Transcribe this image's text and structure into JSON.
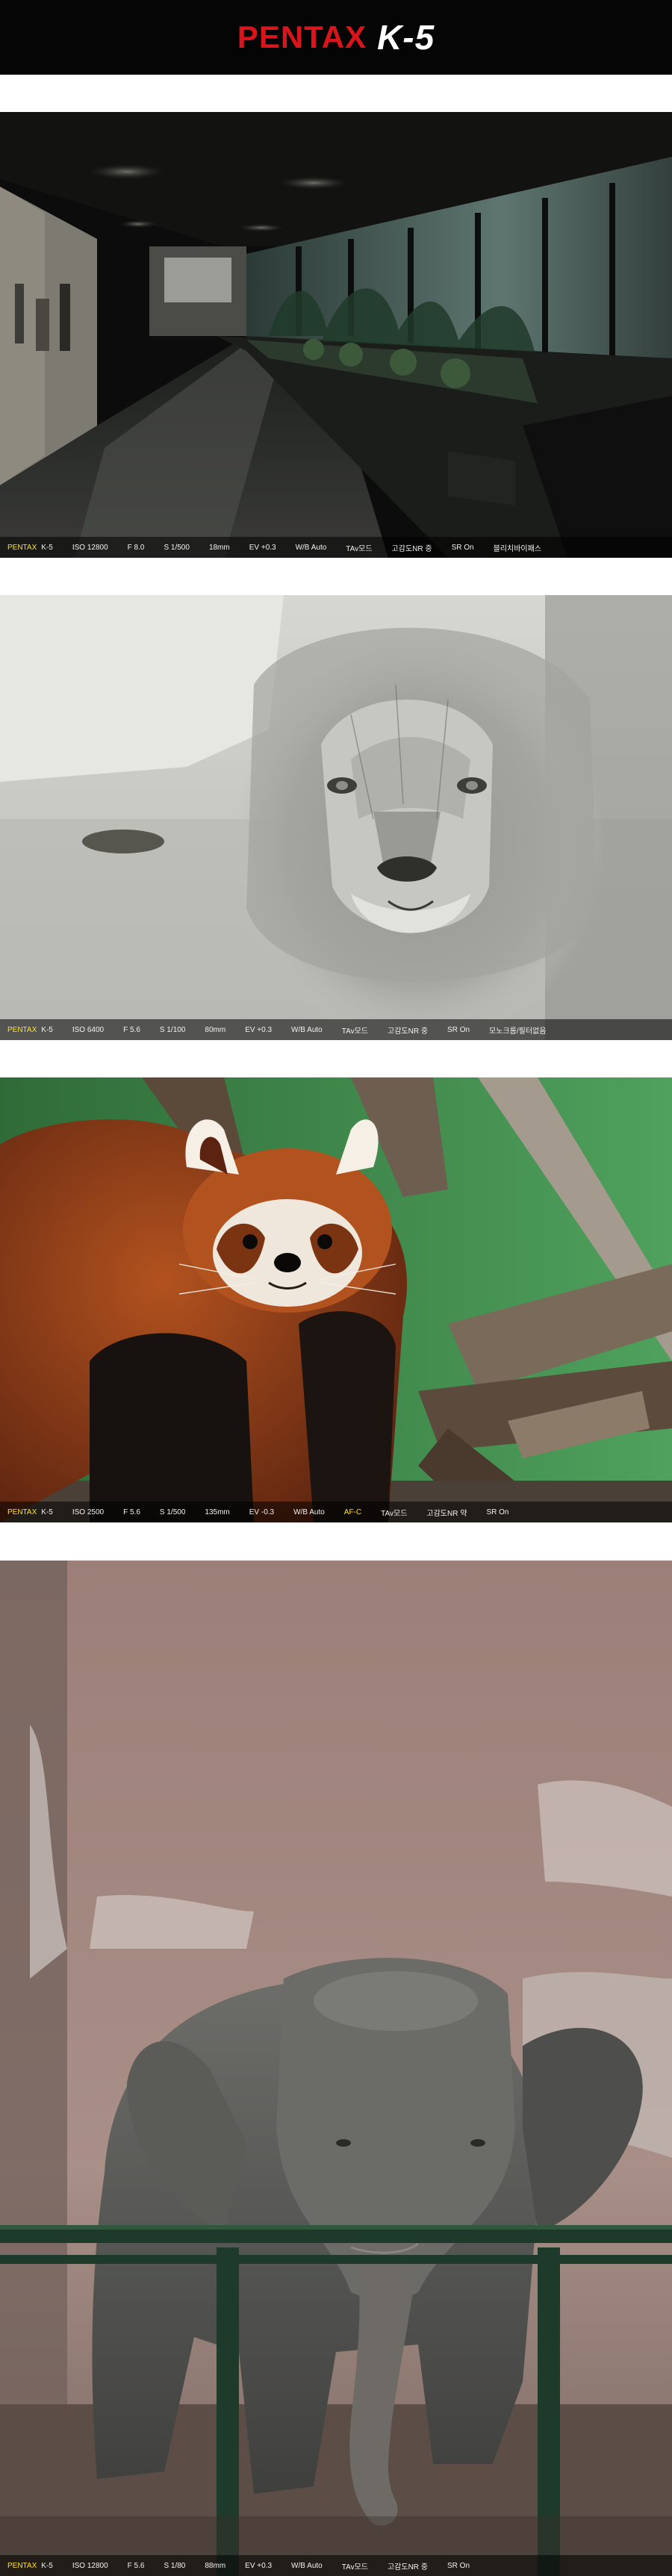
{
  "header": {
    "brand": "PENTAX",
    "model": "K-5"
  },
  "photos": [
    {
      "subject": "corridor",
      "exif": {
        "brand": "PENTAX",
        "model": "K-5",
        "iso": "ISO 12800",
        "aperture": "F 8.0",
        "shutter": "S 1/500",
        "focal": "18mm",
        "ev": "EV +0.3",
        "wb": "W/B Auto",
        "mode": "TAv모드",
        "nr": "고감도NR 중",
        "sr": "SR On",
        "effect": "블리치바이패스"
      }
    },
    {
      "subject": "lion",
      "exif": {
        "brand": "PENTAX",
        "model": "K-5",
        "iso": "ISO 6400",
        "aperture": "F 5.6",
        "shutter": "S 1/100",
        "focal": "80mm",
        "ev": "EV +0.3",
        "wb": "W/B Auto",
        "mode": "TAv모드",
        "nr": "고감도NR 중",
        "sr": "SR On",
        "effect": "모노크롬/필터없음"
      }
    },
    {
      "subject": "red-panda",
      "exif": {
        "brand": "PENTAX",
        "model": "K-5",
        "iso": "ISO 2500",
        "aperture": "F 5.6",
        "shutter": "S 1/500",
        "focal": "135mm",
        "ev": "EV -0.3",
        "wb": "W/B Auto",
        "af": "AF-C",
        "mode": "TAv모드",
        "nr": "고감도NR 약",
        "sr": "SR On"
      }
    },
    {
      "subject": "elephant",
      "exif": {
        "brand": "PENTAX",
        "model": "K-5",
        "iso": "ISO 12800",
        "aperture": "F 5.6",
        "shutter": "S 1/80",
        "focal": "88mm",
        "ev": "EV +0.3",
        "wb": "W/B Auto",
        "mode": "TAv모드",
        "nr": "고감도NR 중",
        "sr": "SR On"
      }
    }
  ],
  "colors": {
    "brand_red": "#d9141a",
    "exif_highlight": "#ffe21a"
  }
}
